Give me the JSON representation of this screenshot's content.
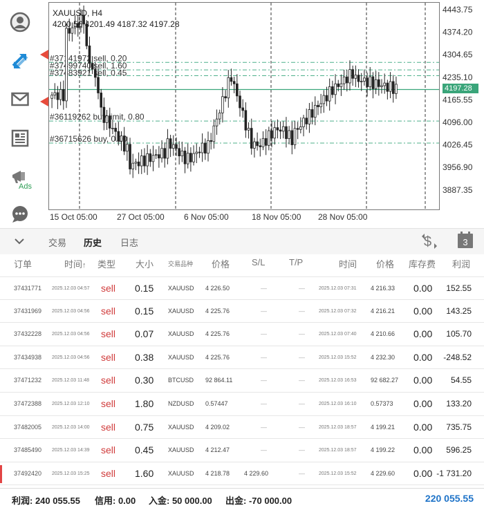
{
  "chart": {
    "symbol_tf": "XAUUSD, H4",
    "ohlc": "4200.56 4201.49 4187.32 4197.28",
    "current_price": "4197.28",
    "price_labels": [
      "4443.75",
      "4374.20",
      "4304.65",
      "4235.10",
      "4165.55",
      "4096.00",
      "4026.45",
      "3956.90",
      "3887.35"
    ],
    "date_labels": [
      "15 Oct 05:00",
      "27 Oct 05:00",
      "6 Nov 05:00",
      "18 Nov 05:00",
      "28 Nov 05:00"
    ],
    "order_lines": [
      {
        "label": "#37141972 sell, 0.20"
      },
      {
        "label": "#37499740 sell, 1.60"
      },
      {
        "label": "#37483921 sell, 0.45"
      },
      {
        "label": "#36119262 buy limit, 0.80"
      },
      {
        "label": "#36715626 buy, 0.10"
      }
    ]
  },
  "sidebar": {
    "ads_label": "Ads"
  },
  "tabs": [
    {
      "label": "交易"
    },
    {
      "label": "历史"
    },
    {
      "label": "日志"
    }
  ],
  "calendar_badge": "3",
  "table": {
    "headers": {
      "order": "订单",
      "time": "时间",
      "type": "类型",
      "size": "大小",
      "symbol": "交易品种",
      "price": "价格",
      "sl": "S/L",
      "tp": "T/P",
      "time2": "时间",
      "price2": "价格",
      "swap": "库存费",
      "profit": "利润"
    },
    "sort_arrow": "↑",
    "rows": [
      {
        "order": "37431771",
        "time1": "2025.12.03 04:57",
        "type": "sell",
        "size": "0.15",
        "symbol": "XAUUSD",
        "price1": "4 226.50",
        "sl": "",
        "time2": "2025.12.03 07:31",
        "price2": "4 216.33",
        "swap": "0.00",
        "profit": "152.55"
      },
      {
        "order": "37431969",
        "time1": "2025.12.03 04:56",
        "type": "sell",
        "size": "0.15",
        "symbol": "XAUUSD",
        "price1": "4 225.76",
        "sl": "",
        "time2": "2025.12.03 07:32",
        "price2": "4 216.21",
        "swap": "0.00",
        "profit": "143.25"
      },
      {
        "order": "37432228",
        "time1": "2025.12.03 04:56",
        "type": "sell",
        "size": "0.07",
        "symbol": "XAUUSD",
        "price1": "4 225.76",
        "sl": "",
        "time2": "2025.12.03 07:40",
        "price2": "4 210.66",
        "swap": "0.00",
        "profit": "105.70"
      },
      {
        "order": "37434938",
        "time1": "2025.12.03 04:56",
        "type": "sell",
        "size": "0.38",
        "symbol": "XAUUSD",
        "price1": "4 225.76",
        "sl": "",
        "time2": "2025.12.03 15:52",
        "price2": "4 232.30",
        "swap": "0.00",
        "profit": "-248.52"
      },
      {
        "order": "37471232",
        "time1": "2025.12.03 11:48",
        "type": "sell",
        "size": "0.30",
        "symbol": "BTCUSD",
        "price1": "92 864.11",
        "sl": "",
        "time2": "2025.12.03 16:53",
        "price2": "92 682.27",
        "swap": "0.00",
        "profit": "54.55"
      },
      {
        "order": "37472388",
        "time1": "2025.12.03 12:10",
        "type": "sell",
        "size": "1.80",
        "symbol": "NZDUSD",
        "price1": "0.57447",
        "sl": "",
        "time2": "2025.12.03 16:10",
        "price2": "0.57373",
        "swap": "0.00",
        "profit": "133.20"
      },
      {
        "order": "37482005",
        "time1": "2025.12.03 14:00",
        "type": "sell",
        "size": "0.75",
        "symbol": "XAUUSD",
        "price1": "4 209.02",
        "sl": "",
        "time2": "2025.12.03 18:57",
        "price2": "4 199.21",
        "swap": "0.00",
        "profit": "735.75"
      },
      {
        "order": "37485490",
        "time1": "2025.12.03 14:39",
        "type": "sell",
        "size": "0.45",
        "symbol": "XAUUSD",
        "price1": "4 212.47",
        "sl": "",
        "time2": "2025.12.03 18:57",
        "price2": "4 199.22",
        "swap": "0.00",
        "profit": "596.25"
      },
      {
        "order": "37492420",
        "time1": "2025.12.03 15:25",
        "type": "sell",
        "size": "1.60",
        "symbol": "XAUUSD",
        "price1": "4 218.78",
        "sl": "4 229.60",
        "time2": "2025.12.03 15:52",
        "price2": "4 229.60",
        "swap": "0.00",
        "profit": "-1 731.20"
      }
    ],
    "dash": "—"
  },
  "footer": {
    "profit": "利润: 240 055.55",
    "credit": "信用: 0.00",
    "deposit": "入金: 50 000.00",
    "withdrawal": "出金: -70 000.00",
    "balance": "220 055.55"
  }
}
